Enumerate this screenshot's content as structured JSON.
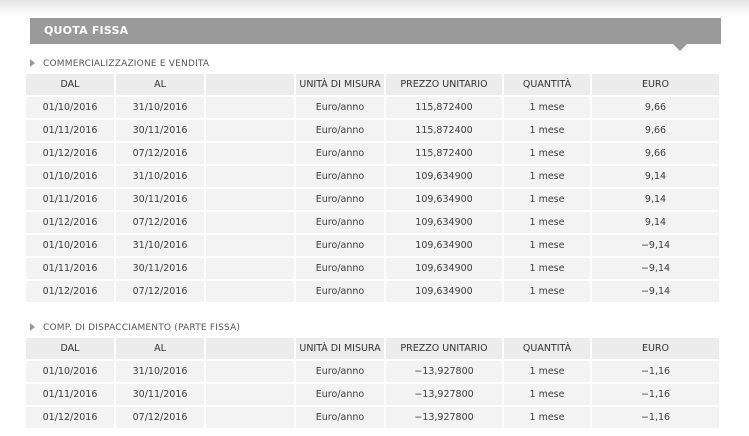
{
  "banner_title": "QUOTA FISSA",
  "sections": [
    {
      "label": "COMMERCIALIZZAZIONE E VENDITA",
      "headers": [
        "DAL",
        "AL",
        "",
        "UNITÀ DI MISURA",
        "PREZZO UNITARIO",
        "QUANTITÀ",
        "EURO"
      ],
      "rows": [
        [
          "01/10/2016",
          "31/10/2016",
          "",
          "Euro/anno",
          "115,872400",
          "1 mese",
          "9,66"
        ],
        [
          "01/11/2016",
          "30/11/2016",
          "",
          "Euro/anno",
          "115,872400",
          "1 mese",
          "9,66"
        ],
        [
          "01/12/2016",
          "07/12/2016",
          "",
          "Euro/anno",
          "115,872400",
          "1 mese",
          "9,66"
        ],
        [
          "01/10/2016",
          "31/10/2016",
          "",
          "Euro/anno",
          "109,634900",
          "1 mese",
          "9,14"
        ],
        [
          "01/11/2016",
          "30/11/2016",
          "",
          "Euro/anno",
          "109,634900",
          "1 mese",
          "9,14"
        ],
        [
          "01/12/2016",
          "07/12/2016",
          "",
          "Euro/anno",
          "109,634900",
          "1 mese",
          "9,14"
        ],
        [
          "01/10/2016",
          "31/10/2016",
          "",
          "Euro/anno",
          "109,634900",
          "1 mese",
          "−9,14"
        ],
        [
          "01/11/2016",
          "30/11/2016",
          "",
          "Euro/anno",
          "109,634900",
          "1 mese",
          "−9,14"
        ],
        [
          "01/12/2016",
          "07/12/2016",
          "",
          "Euro/anno",
          "109,634900",
          "1 mese",
          "−9,14"
        ]
      ]
    },
    {
      "label": "COMP. DI DISPACCIAMENTO (PARTE FISSA)",
      "headers": [
        "DAL",
        "AL",
        "",
        "UNITÀ DI MISURA",
        "PREZZO UNITARIO",
        "QUANTITÀ",
        "EURO"
      ],
      "rows": [
        [
          "01/10/2016",
          "31/10/2016",
          "",
          "Euro/anno",
          "−13,927800",
          "1 mese",
          "−1,16"
        ],
        [
          "01/11/2016",
          "30/11/2016",
          "",
          "Euro/anno",
          "−13,927800",
          "1 mese",
          "−1,16"
        ],
        [
          "01/12/2016",
          "07/12/2016",
          "",
          "Euro/anno",
          "−13,927800",
          "1 mese",
          "−1,16"
        ]
      ]
    }
  ]
}
